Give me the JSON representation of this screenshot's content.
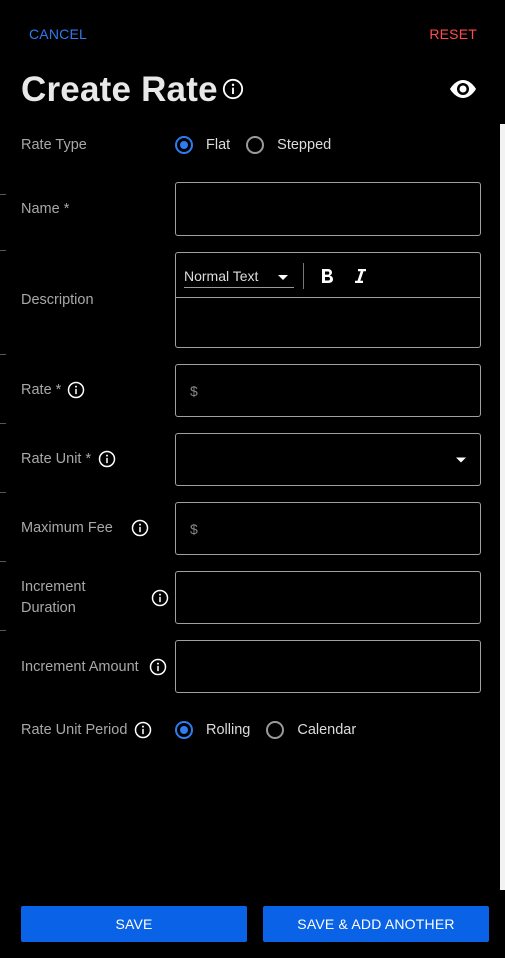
{
  "header": {
    "cancel_label": "CANCEL",
    "reset_label": "RESET",
    "title": "Create Rate"
  },
  "form": {
    "rate_type": {
      "label": "Rate Type",
      "options": [
        "Flat",
        "Stepped"
      ],
      "selected": "Flat"
    },
    "name": {
      "label": "Name *",
      "value": ""
    },
    "description": {
      "label": "Description",
      "format_value": "Normal Text",
      "bold_icon": "bold-icon",
      "italic_icon": "italic-icon"
    },
    "rate": {
      "label": "Rate *",
      "prefix": "$",
      "value": ""
    },
    "rate_unit": {
      "label": "Rate Unit *",
      "value": ""
    },
    "maximum_fee": {
      "label": "Maximum Fee",
      "prefix": "$",
      "value": ""
    },
    "increment_duration": {
      "label_line1": "Increment",
      "label_line2": "Duration",
      "value": ""
    },
    "increment_amount": {
      "label": "Increment Amount",
      "value": ""
    },
    "rate_unit_period": {
      "label": "Rate Unit Period",
      "options": [
        "Rolling",
        "Calendar"
      ],
      "selected": "Rolling"
    }
  },
  "footer": {
    "save_label": "SAVE",
    "save_add_label": "SAVE & ADD ANOTHER"
  },
  "colors": {
    "accent": "#2f7bf0",
    "button": "#0a63e6",
    "reset": "#ff4d4d",
    "background": "#000000"
  },
  "icons": [
    "info-icon",
    "eye-icon",
    "chevron-down-icon",
    "bold-icon",
    "italic-icon"
  ]
}
